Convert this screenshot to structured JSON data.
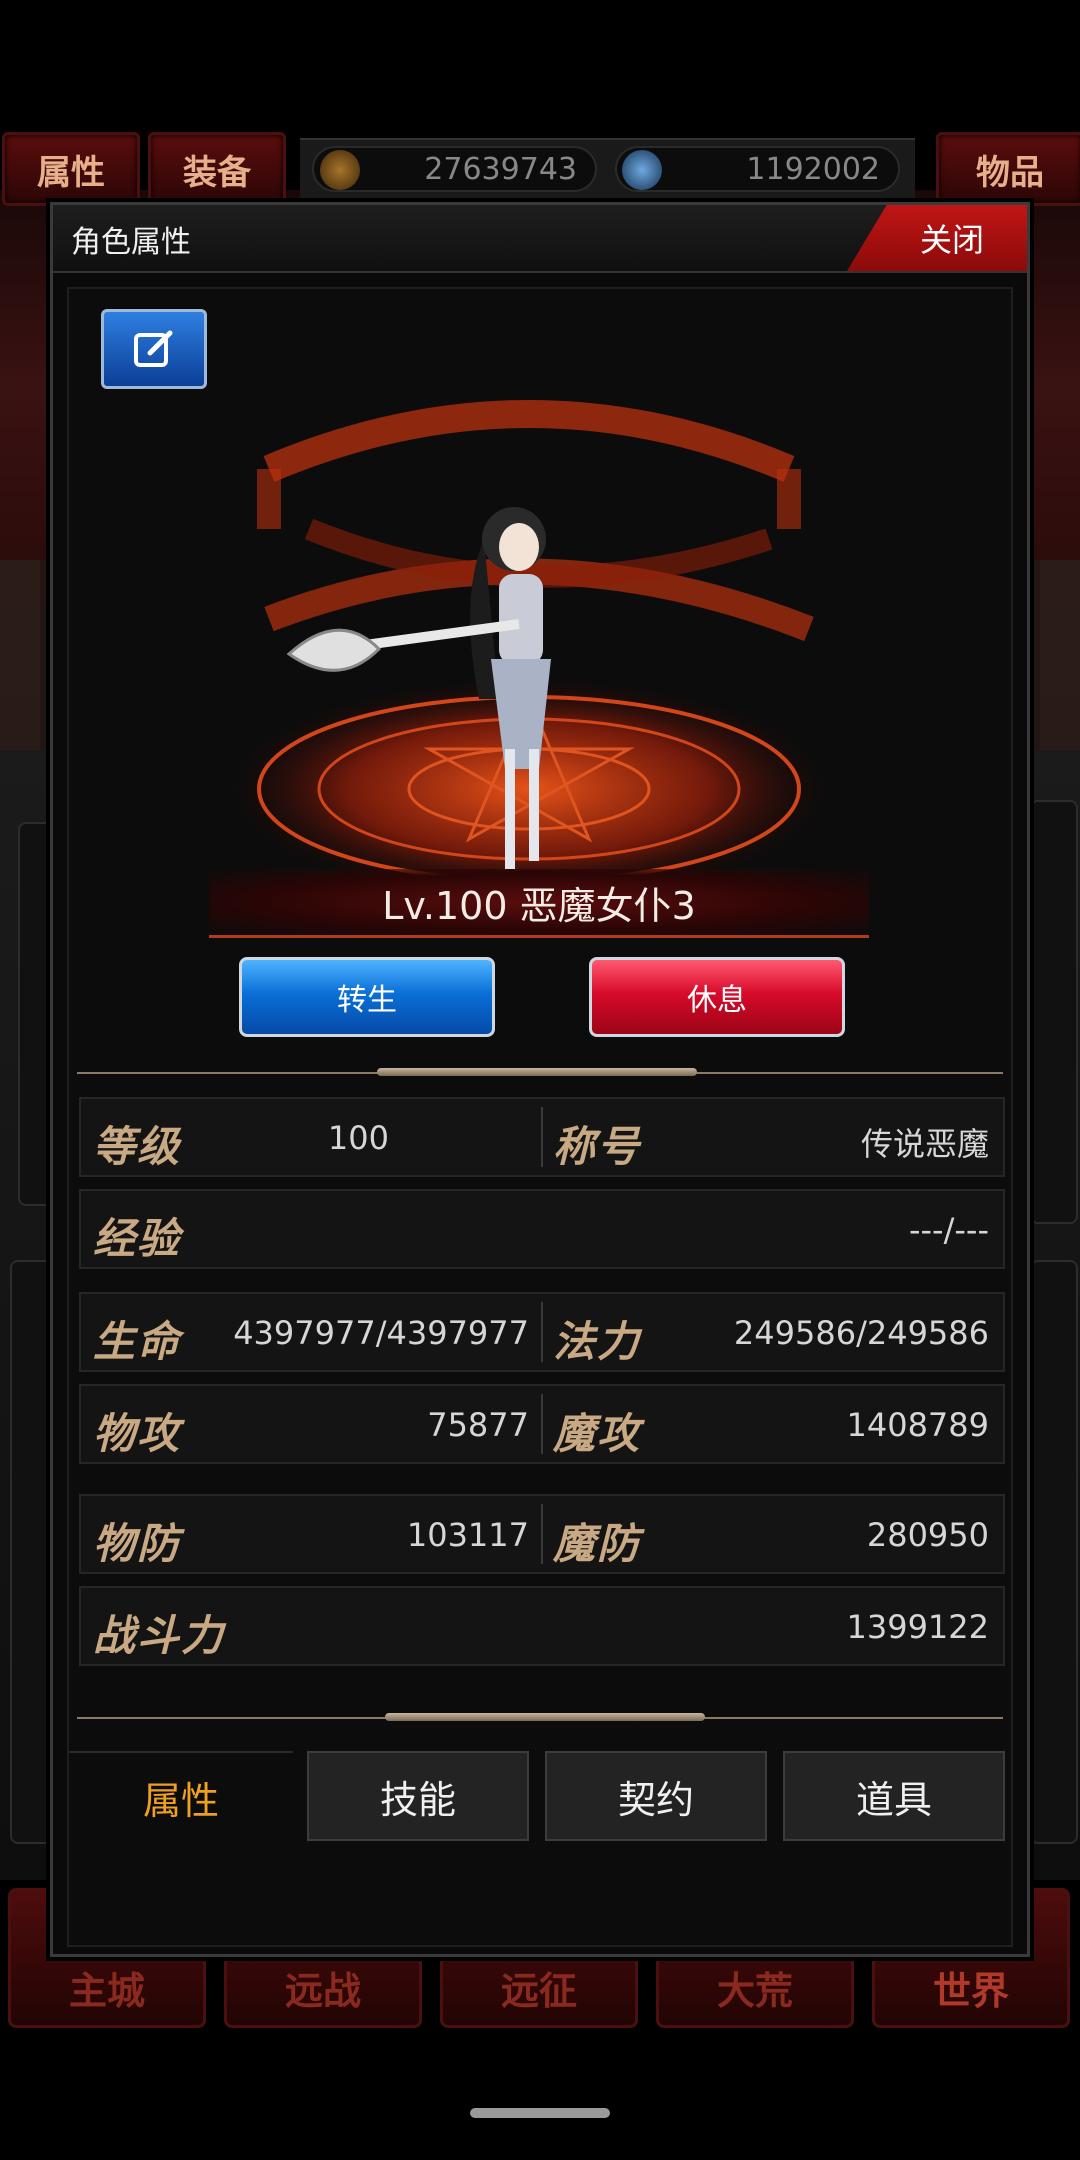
{
  "top_bar": {
    "attributes_label": "属性",
    "equipment_label": "装备",
    "items_label": "物品",
    "gold": "27639743",
    "gems": "1192002"
  },
  "bottom_nav": [
    "主城",
    "远战",
    "远征",
    "大荒",
    "世界"
  ],
  "dialog": {
    "title": "角色属性",
    "close_label": "关闭",
    "character_name": "Lv.100 恶魔女仆3",
    "rebirth_label": "转生",
    "rest_label": "休息"
  },
  "stats": {
    "level_label": "等级",
    "level": "100",
    "title_label": "称号",
    "title": "传说恶魔",
    "exp_label": "经验",
    "exp": "---/---",
    "hp_label": "生命",
    "hp": "4397977/4397977",
    "mp_label": "法力",
    "mp": "249586/249586",
    "patk_label": "物攻",
    "patk": "75877",
    "matk_label": "魔攻",
    "matk": "1408789",
    "pdef_label": "物防",
    "pdef": "103117",
    "mdef_label": "魔防",
    "mdef": "280950",
    "power_label": "战斗力",
    "power": "1399122"
  },
  "tabs": {
    "attributes": "属性",
    "skills": "技能",
    "contract": "契约",
    "items": "道具"
  },
  "colors": {
    "accent_gold": "#f0a020",
    "stat_label": "#c8a983",
    "close_red": "#c01515",
    "rebirth_blue": "#0a6fd6",
    "rest_red": "#d80a2a"
  }
}
